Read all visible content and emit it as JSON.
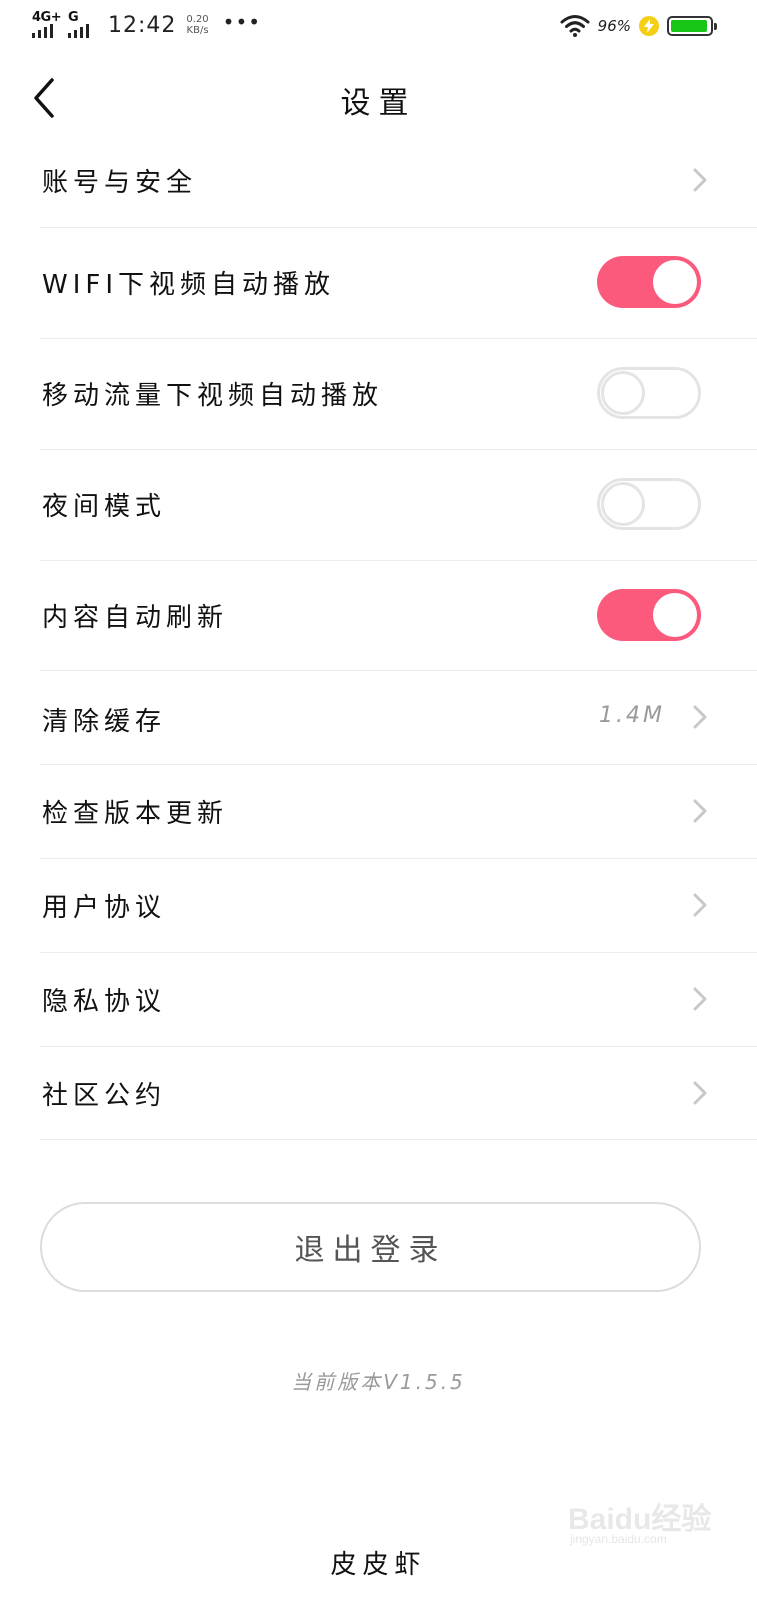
{
  "status_bar": {
    "network_1": "4G+",
    "network_2": "G",
    "time": "12:42",
    "speed_value": "0.20",
    "speed_unit": "KB/s",
    "more": "•••",
    "battery_percent": "96%",
    "battery_level": 0.96,
    "battery_color": "#17c617",
    "icons": [
      "signal-icon",
      "wifi-icon",
      "charging-icon",
      "battery-icon"
    ]
  },
  "header": {
    "title": "设置",
    "back_icon": "chevron-left-icon"
  },
  "settings": {
    "account_security": {
      "label": "账号与安全"
    },
    "wifi_autoplay": {
      "label": "WIFI下视频自动播放",
      "enabled": true
    },
    "mobile_autoplay": {
      "label": "移动流量下视频自动播放",
      "enabled": false
    },
    "night_mode": {
      "label": "夜间模式",
      "enabled": false
    },
    "auto_refresh": {
      "label": "内容自动刷新",
      "enabled": true
    },
    "clear_cache": {
      "label": "清除缓存",
      "value": "1.4M"
    },
    "check_update": {
      "label": "检查版本更新"
    },
    "user_agreement": {
      "label": "用户协议"
    },
    "privacy_agreement": {
      "label": "隐私协议"
    },
    "community_rules": {
      "label": "社区公约"
    }
  },
  "logout": {
    "label": "退出登录"
  },
  "footer": {
    "version": "当前版本V1.5.5",
    "brand": "皮皮虾"
  },
  "watermark": {
    "text": "Baidu经验",
    "sub": "jingyan.baidu.com"
  },
  "colors": {
    "accent": "#fb5a7d",
    "toggle_off_border": "#e4e4e4",
    "divider": "#ececec"
  }
}
